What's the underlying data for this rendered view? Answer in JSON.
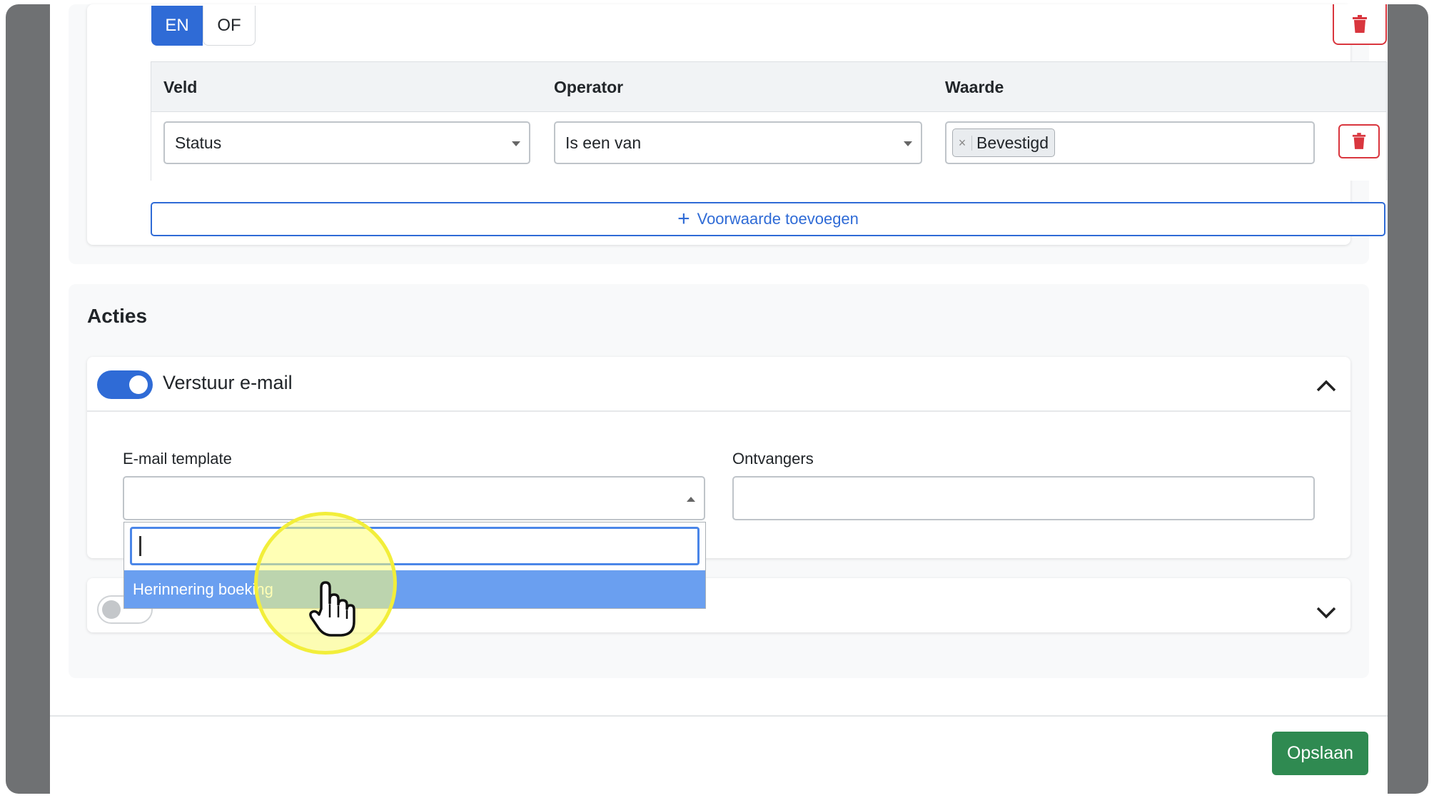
{
  "logic": {
    "and_label": "EN",
    "or_label": "OF"
  },
  "conditions": {
    "headers": {
      "field": "Veld",
      "operator": "Operator",
      "value": "Waarde"
    },
    "row": {
      "field_value": "Status",
      "operator_value": "Is een van",
      "value_tag": "Bevestigd",
      "tag_remove": "×"
    },
    "add_label": "Voorwaarde toevoegen",
    "add_icon": "+"
  },
  "actions": {
    "title": "Acties",
    "send_email": {
      "label": "Verstuur e-mail",
      "enabled": true,
      "template_label": "E-mail template",
      "template_value": "",
      "recipients_label": "Ontvangers",
      "recipients_value": ""
    },
    "dropdown": {
      "search_value": "",
      "options": [
        "Herinnering boeking"
      ]
    },
    "second_action": {
      "enabled": false
    }
  },
  "footer": {
    "save_label": "Opslaan"
  },
  "colors": {
    "primary": "#2f6bd6",
    "danger": "#d9363e",
    "success": "#2f8a51",
    "highlight": "#f2ee3a"
  },
  "icons": [
    "trash-icon",
    "chevron-up-icon",
    "chevron-down-icon",
    "plus-icon",
    "hand-cursor-icon"
  ]
}
